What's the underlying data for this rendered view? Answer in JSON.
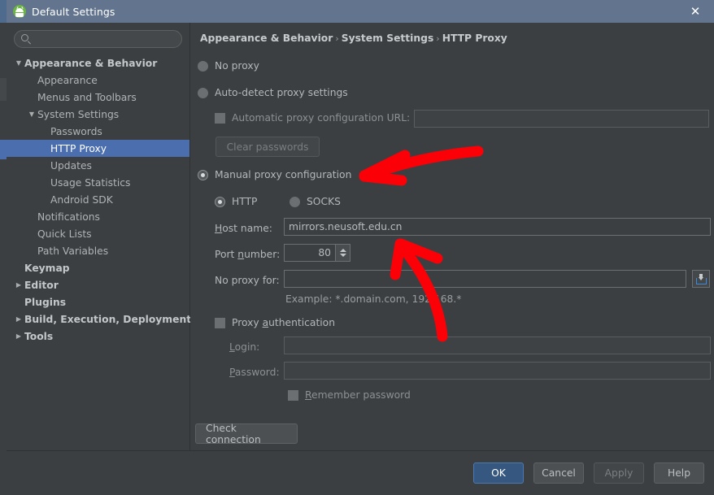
{
  "window": {
    "title": "Default Settings",
    "icon": "android-studio-icon",
    "close_label": "✕"
  },
  "sidebar": {
    "search": {
      "value": "",
      "placeholder": "",
      "icon": "search-icon"
    },
    "items": [
      {
        "label": "Appearance & Behavior",
        "indent": 0,
        "twisty": "▼",
        "bold": true,
        "selected": false
      },
      {
        "label": "Appearance",
        "indent": 1,
        "twisty": "",
        "bold": false,
        "selected": false
      },
      {
        "label": "Menus and Toolbars",
        "indent": 1,
        "twisty": "",
        "bold": false,
        "selected": false
      },
      {
        "label": "System Settings",
        "indent": 1,
        "twisty": "▼",
        "bold": false,
        "selected": false
      },
      {
        "label": "Passwords",
        "indent": 2,
        "twisty": "",
        "bold": false,
        "selected": false
      },
      {
        "label": "HTTP Proxy",
        "indent": 2,
        "twisty": "",
        "bold": false,
        "selected": true
      },
      {
        "label": "Updates",
        "indent": 2,
        "twisty": "",
        "bold": false,
        "selected": false
      },
      {
        "label": "Usage Statistics",
        "indent": 2,
        "twisty": "",
        "bold": false,
        "selected": false
      },
      {
        "label": "Android SDK",
        "indent": 2,
        "twisty": "",
        "bold": false,
        "selected": false
      },
      {
        "label": "Notifications",
        "indent": 1,
        "twisty": "",
        "bold": false,
        "selected": false
      },
      {
        "label": "Quick Lists",
        "indent": 1,
        "twisty": "",
        "bold": false,
        "selected": false
      },
      {
        "label": "Path Variables",
        "indent": 1,
        "twisty": "",
        "bold": false,
        "selected": false
      },
      {
        "label": "Keymap",
        "indent": 0,
        "twisty": "",
        "bold": true,
        "selected": false
      },
      {
        "label": "Editor",
        "indent": 0,
        "twisty": "▶",
        "bold": true,
        "selected": false
      },
      {
        "label": "Plugins",
        "indent": 0,
        "twisty": "",
        "bold": true,
        "selected": false
      },
      {
        "label": "Build, Execution, Deployment",
        "indent": 0,
        "twisty": "▶",
        "bold": true,
        "selected": false
      },
      {
        "label": "Tools",
        "indent": 0,
        "twisty": "▶",
        "bold": true,
        "selected": false
      }
    ]
  },
  "breadcrumb": {
    "part1": "Appearance & Behavior",
    "sep1": "›",
    "part2": "System Settings",
    "sep2": "›",
    "part3": "HTTP Proxy"
  },
  "proxy": {
    "mode_no_proxy": {
      "label": "No proxy",
      "selected": false
    },
    "mode_auto_detect": {
      "label": "Auto-detect proxy settings",
      "selected": false
    },
    "auto_config_url": {
      "label": "Automatic proxy configuration URL:",
      "checked": false,
      "enabled": false,
      "value": ""
    },
    "clear_passwords_button": {
      "label": "Clear passwords",
      "enabled": false
    },
    "mode_manual": {
      "label": "Manual proxy configuration",
      "selected": true
    },
    "protocol_http": {
      "label": "HTTP",
      "selected": true
    },
    "protocol_socks": {
      "label": "SOCKS",
      "selected": false
    },
    "host_name": {
      "label": "Host name:",
      "mnemonic": "H",
      "value": "mirrors.neusoft.edu.cn"
    },
    "port_number": {
      "label": "Port number:",
      "mnemonic": "n",
      "value": "80"
    },
    "no_proxy_for": {
      "label": "No proxy for:",
      "value": "",
      "import_icon": "import-list-icon"
    },
    "example_hint": "Example: *.domain.com, 192.168.*",
    "proxy_authentication": {
      "label": "Proxy authentication",
      "mnemonic": "a",
      "checked": false
    },
    "login": {
      "label": "Login:",
      "mnemonic": "L",
      "value": ""
    },
    "password": {
      "label": "Password:",
      "mnemonic": "P",
      "value": ""
    },
    "remember_password": {
      "label": "Remember password",
      "mnemonic": "R",
      "checked": false,
      "enabled": false
    },
    "check_connection_button": {
      "label": "Check connection"
    }
  },
  "footer": {
    "ok": {
      "label": "OK",
      "default": true
    },
    "cancel": {
      "label": "Cancel"
    },
    "apply": {
      "label": "Apply",
      "enabled": false
    },
    "help": {
      "label": "Help"
    }
  },
  "annotations": {
    "arrow1": "red-arrow-pointing-to-manual-proxy-configuration",
    "arrow2": "red-arrow-pointing-to-port-number",
    "color": "#fb0007"
  }
}
